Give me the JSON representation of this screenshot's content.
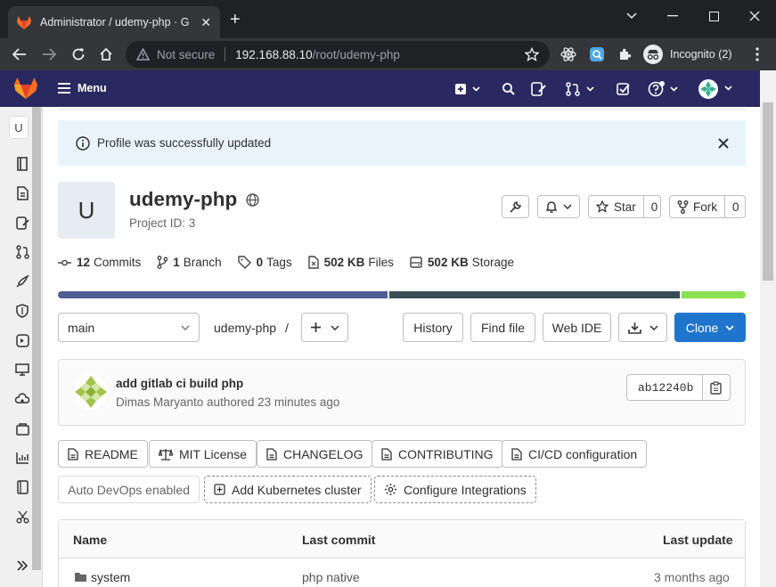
{
  "browser": {
    "tab_title": "Administrator / udemy-php · GitL",
    "security_label": "Not secure",
    "url_host": "192.168.88.10",
    "url_path": "/root/udemy-php",
    "incognito_label": "Incognito (2)"
  },
  "gitlab": {
    "menu_label": "Menu"
  },
  "sidebar": {
    "avatar_letter": "U"
  },
  "flash": {
    "message": "Profile was successfully updated"
  },
  "project": {
    "avatar_letter": "U",
    "name": "udemy-php",
    "id_text": "Project ID: 3",
    "star_label": "Star",
    "star_count": "0",
    "fork_label": "Fork",
    "fork_count": "0"
  },
  "stats": [
    {
      "value": "12",
      "label": "Commits"
    },
    {
      "value": "1",
      "label": "Branch"
    },
    {
      "value": "0",
      "label": "Tags"
    },
    {
      "value": "502 KB",
      "label": "Files"
    },
    {
      "value": "502 KB",
      "label": "Storage"
    }
  ],
  "language_bar": [
    {
      "fraction": 0.482,
      "color": "#4f5d95"
    },
    {
      "fraction": 0.425,
      "color": "#384d54"
    },
    {
      "fraction": 0.093,
      "color": "#89e051"
    }
  ],
  "repo_nav": {
    "branch": "main",
    "path_name": "udemy-php",
    "path_sep": "/",
    "history": "History",
    "find_file": "Find file",
    "web_ide": "Web IDE",
    "clone": "Clone"
  },
  "commit": {
    "title": "add gitlab ci build php",
    "author": "Dimas Maryanto",
    "meta": "authored 23 minutes ago",
    "sha": "ab12240b"
  },
  "quick_links": {
    "readme": "README",
    "license": "MIT License",
    "changelog": "CHANGELOG",
    "contributing": "CONTRIBUTING",
    "cicd": "CI/CD configuration",
    "autodevops": "Auto DevOps enabled",
    "kubernetes": "Add Kubernetes cluster",
    "integrations": "Configure Integrations"
  },
  "table": {
    "headers": {
      "name": "Name",
      "last_commit": "Last commit",
      "last_update": "Last update"
    },
    "rows": [
      {
        "name": "system",
        "last_commit": "php native",
        "last_update": "3 months ago"
      }
    ]
  },
  "colors": {
    "gitlab_nav": "#292961",
    "clone_button": "#1f75cb",
    "flash_bg": "#e9f3fc"
  }
}
